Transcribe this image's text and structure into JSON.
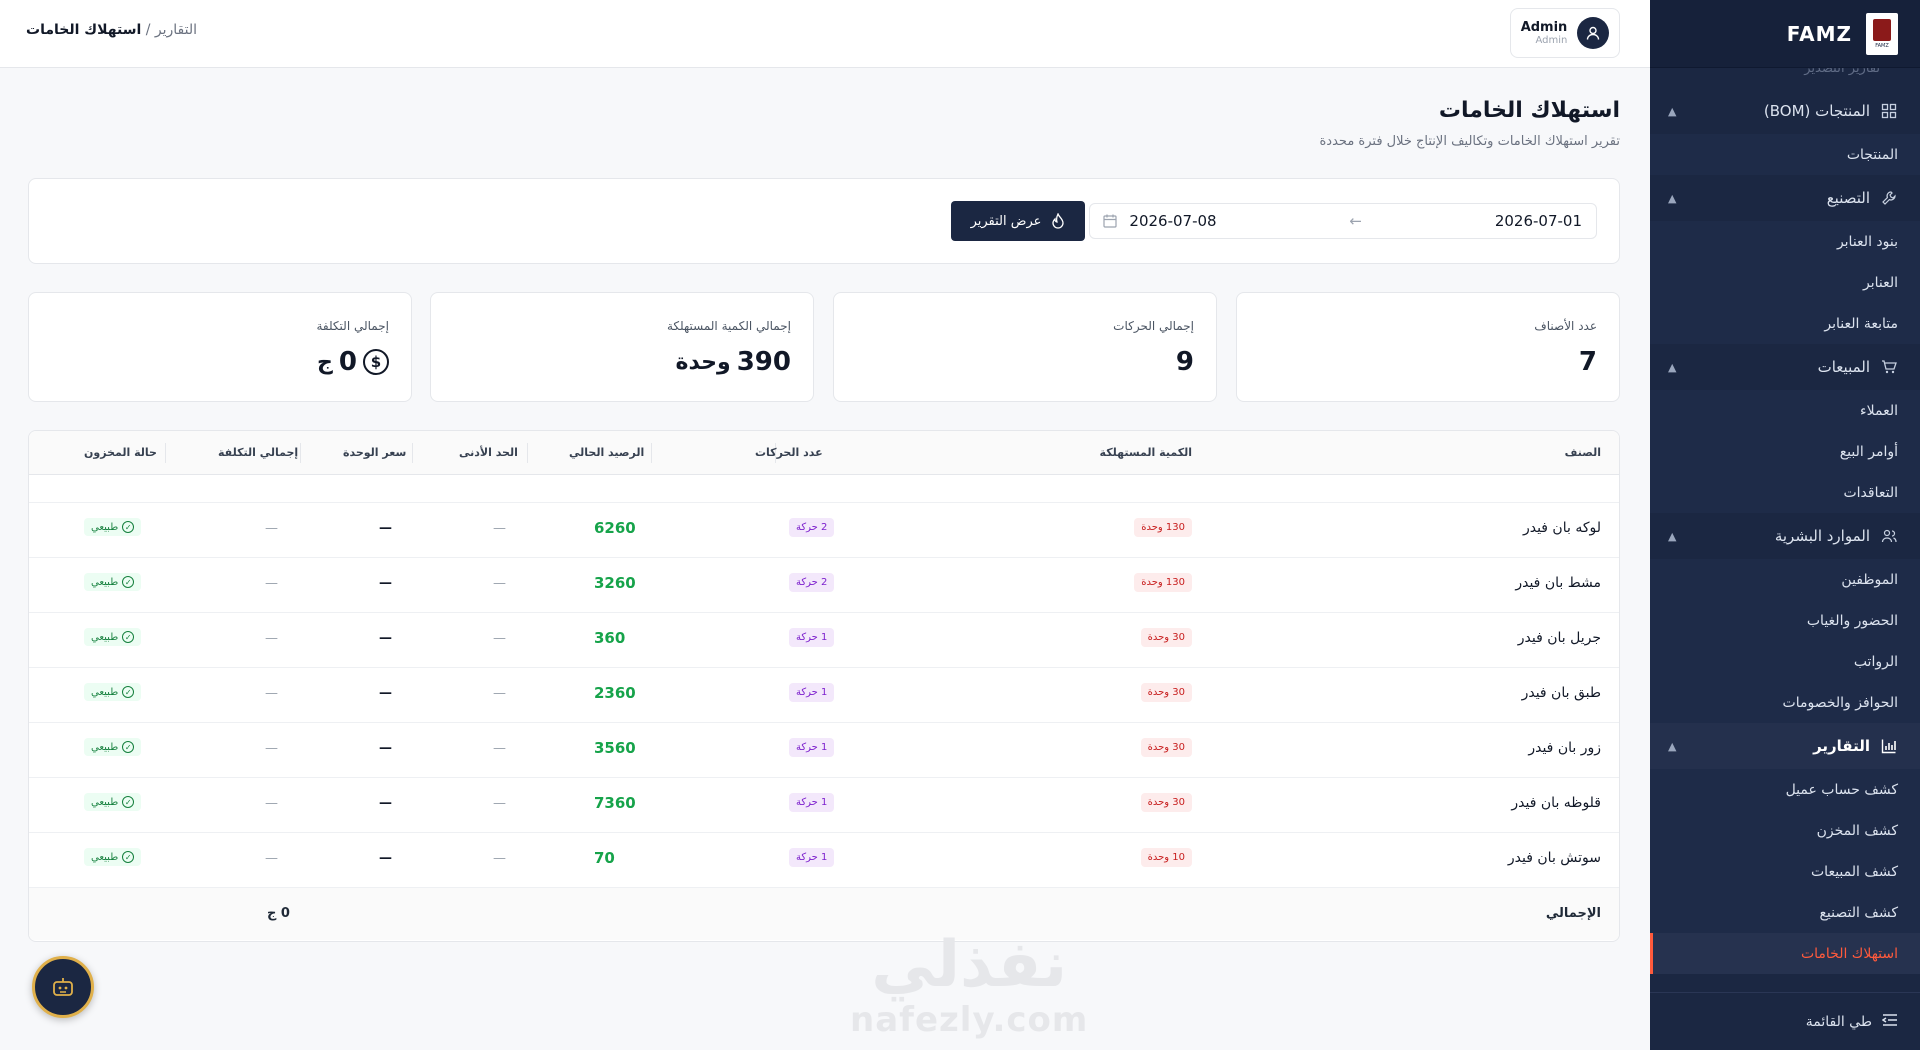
{
  "brand": {
    "name": "FAMZ",
    "logo_text": "FAMZ"
  },
  "sidebar": {
    "partial_item": "تقارير التصدير",
    "groups": [
      {
        "label": "المنتجات (BOM)",
        "icon": "grid-icon",
        "items": [
          "المنتجات"
        ]
      },
      {
        "label": "التصنيع",
        "icon": "wrench-icon",
        "items": [
          "بنود العنابر",
          "العنابر",
          "متابعة العنابر"
        ]
      },
      {
        "label": "المبيعات",
        "icon": "cart-icon",
        "items": [
          "العملاء",
          "أوامر البيع",
          "التعاقدات"
        ]
      },
      {
        "label": "الموارد البشرية",
        "icon": "users-icon",
        "items": [
          "الموظفين",
          "الحضور والغياب",
          "الرواتب",
          "الحوافز والخصومات"
        ]
      },
      {
        "label": "التقارير",
        "icon": "chart-icon",
        "items": [
          "كشف حساب عميل",
          "كشف المخزن",
          "كشف المبيعات",
          "كشف التصنيع",
          "استهلاك الخامات"
        ]
      }
    ],
    "collapse_label": "طي القائمة"
  },
  "topbar": {
    "breadcrumb_parent": "التقارير",
    "breadcrumb_sep": "/",
    "breadcrumb_current": "استهلاك الخامات",
    "user_name": "Admin",
    "user_role": "Admin"
  },
  "page": {
    "title": "استهلاك الخامات",
    "subtitle": "تقرير استهلاك الخامات وتكاليف الإنتاج خلال فترة محددة"
  },
  "filter": {
    "date_from": "2026-07-01",
    "date_to": "2026-07-08",
    "arrow": "←",
    "button_label": "عرض التقرير"
  },
  "stats": [
    {
      "label": "عدد الأصناف",
      "value": "7",
      "unit": ""
    },
    {
      "label": "إجمالي الحركات",
      "value": "9",
      "unit": ""
    },
    {
      "label": "إجمالي الكمية المستهلكة",
      "value": "390",
      "unit": "وحدة"
    },
    {
      "label": "إجمالي التكلفة",
      "value": "0",
      "unit": "ج"
    }
  ],
  "table": {
    "headers": [
      "الصنف",
      "الكمية المستهلكة",
      "عدد الحركات",
      "الرصيد الحالي",
      "الحد الأدنى",
      "سعر الوحدة",
      "إجمالي التكلفة",
      "حالة المخزون"
    ],
    "rows": [
      {
        "name": "لوكه بان فيدر",
        "qty": "130 وحدة",
        "moves": "2 حركة",
        "balance": "6260",
        "min": "—",
        "price": "—",
        "cost": "—",
        "status": "طبيعي"
      },
      {
        "name": "مشط بان فيدر",
        "qty": "130 وحدة",
        "moves": "2 حركة",
        "balance": "3260",
        "min": "—",
        "price": "—",
        "cost": "—",
        "status": "طبيعي"
      },
      {
        "name": "جريل بان فيدر",
        "qty": "30 وحدة",
        "moves": "1 حركة",
        "balance": "360",
        "min": "—",
        "price": "—",
        "cost": "—",
        "status": "طبيعي"
      },
      {
        "name": "طبق بان فيدر",
        "qty": "30 وحدة",
        "moves": "1 حركة",
        "balance": "2360",
        "min": "—",
        "price": "—",
        "cost": "—",
        "status": "طبيعي"
      },
      {
        "name": "زور بان فيدر",
        "qty": "30 وحدة",
        "moves": "1 حركة",
        "balance": "3560",
        "min": "—",
        "price": "—",
        "cost": "—",
        "status": "طبيعي"
      },
      {
        "name": "قلوظه بان فيدر",
        "qty": "30 وحدة",
        "moves": "1 حركة",
        "balance": "7360",
        "min": "—",
        "price": "—",
        "cost": "—",
        "status": "طبيعي"
      },
      {
        "name": "سوتش بان فيدر",
        "qty": "10 وحدة",
        "moves": "1 حركة",
        "balance": "70",
        "min": "—",
        "price": "—",
        "cost": "—",
        "status": "طبيعي"
      }
    ],
    "footer_label": "الإجمالي",
    "footer_total": "0 ج"
  },
  "watermark": {
    "arabic": "نفذلي",
    "latin": "nafezly.com"
  },
  "colors": {
    "sidebar": "#1b2742",
    "accent": "#ff5a3c",
    "positive": "#16a34a"
  }
}
